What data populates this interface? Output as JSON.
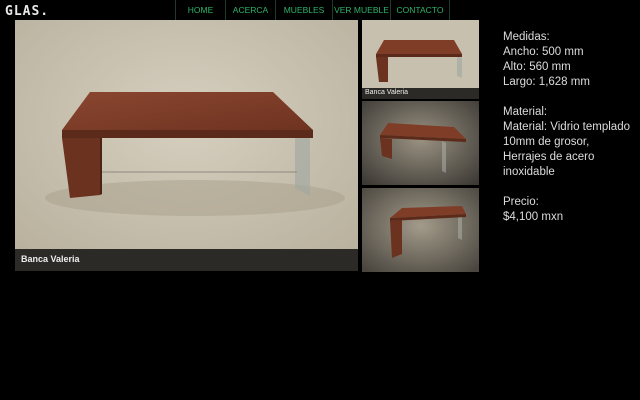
{
  "brand": {
    "logo_text": "GLAS."
  },
  "nav": [
    {
      "label": "HOME"
    },
    {
      "label": "ACERCA"
    },
    {
      "label": "MUEBLES"
    },
    {
      "label": "VER MUEBLE"
    },
    {
      "label": "CONTACTO"
    }
  ],
  "main_image": {
    "caption": "Banca Valeria"
  },
  "thumbnails": [
    {
      "caption": "Banca Valeria"
    },
    {
      "caption": ""
    },
    {
      "caption": ""
    }
  ],
  "details": {
    "medidas_heading": "Medidas:",
    "ancho": "Ancho: 500 mm",
    "alto": "Alto: 560 mm",
    "largo": "Largo: 1,628 mm",
    "material_heading": "Material:",
    "material_line1": "Material: Vidrio templado",
    "material_line2": "10mm de grosor,",
    "material_line3": "Herrajes de acero",
    "material_line4": "inoxidable",
    "precio_heading": "Precio:",
    "precio_value": "$4,100 mxn"
  },
  "colors": {
    "nav_text": "#2fb36a",
    "background": "#000000",
    "wood": "#7a3a26"
  }
}
